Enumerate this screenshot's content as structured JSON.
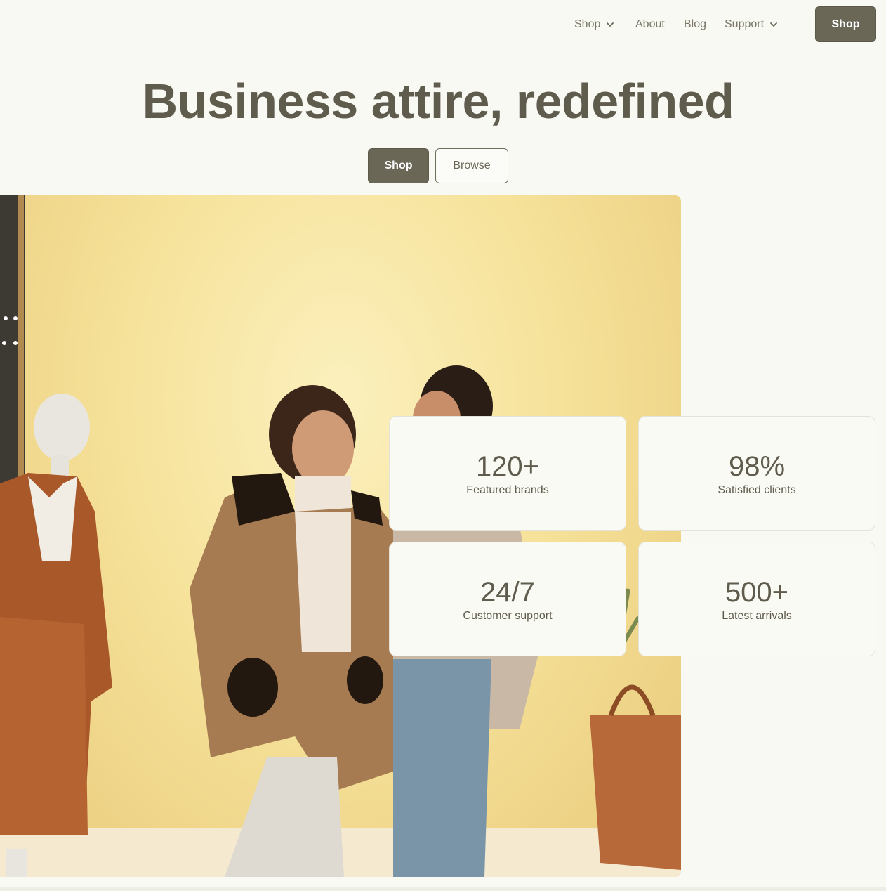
{
  "nav": {
    "items": [
      {
        "label": "Shop",
        "has_dropdown": true
      },
      {
        "label": "About",
        "has_dropdown": false
      },
      {
        "label": "Blog",
        "has_dropdown": false
      },
      {
        "label": "Support",
        "has_dropdown": true
      }
    ],
    "cta_label": "Shop"
  },
  "hero": {
    "title": "Business attire, redefined",
    "primary_button": "Shop",
    "secondary_button": "Browse"
  },
  "stats": [
    {
      "value": "120+",
      "label": "Featured brands"
    },
    {
      "value": "98%",
      "label": "Satisfied clients"
    },
    {
      "value": "24/7",
      "label": "Customer support"
    },
    {
      "value": "500+",
      "label": "Latest arrivals"
    }
  ],
  "colors": {
    "background": "#f9f9f4",
    "accent": "#6a6757",
    "text": "#5f5c4d"
  },
  "icons": {
    "dropdown": "chevron-down-icon"
  }
}
